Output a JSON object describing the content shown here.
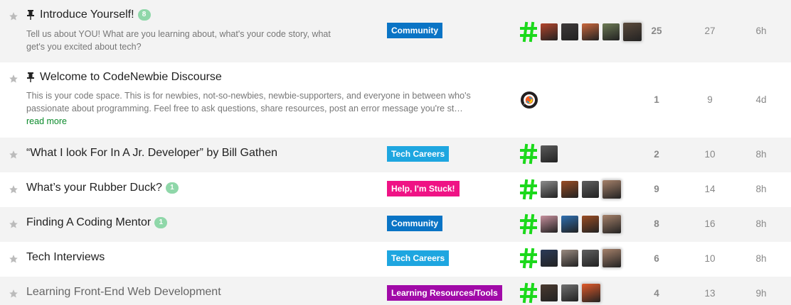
{
  "colors": {
    "row_alt": "#f3f3f3",
    "hash": "#1bd91b",
    "badge": "#8fd7a9",
    "link": "#0a8a2a"
  },
  "topics": [
    {
      "title": "Introduce Yourself!",
      "pinned": true,
      "badge": "8",
      "excerpt": [
        "Tell us about YOU! What are you learning about, what's your code story, what",
        "get's you excited about tech?"
      ],
      "category": {
        "label": "Community",
        "color": "#0a74c5"
      },
      "poster_icon": "hash-icon",
      "avatars": [
        "#b3452c",
        "#3e3a3a",
        "#c9673c",
        "#6d7b55",
        "#5b4a3c"
      ],
      "replies": "25",
      "views": "27",
      "activity": "6h"
    },
    {
      "title": "Welcome to CodeNewbie Discourse",
      "pinned": true,
      "excerpt": [
        "This is your code space. This is for newbies, not-so-newbies, newbie-supporters, and everyone in between who's",
        "passionate about programming. Feel free to ask questions, share resources, post an error message you're st…"
      ],
      "read_more": "read more",
      "poster_icon": "discourse-logo-icon",
      "replies": "1",
      "views": "9",
      "activity": "4d"
    },
    {
      "title": "“What I look For In A Jr. Developer” by Bill Gathen",
      "category": {
        "label": "Tech Careers",
        "color": "#1ea6e0"
      },
      "poster_icon": "hash-icon",
      "avatars": [
        "#5a5a5a"
      ],
      "replies": "2",
      "views": "10",
      "activity": "8h"
    },
    {
      "title": "What’s your Rubber Duck?",
      "badge": "1",
      "category": {
        "label": "Help, I'm Stuck!",
        "color": "#ef1385"
      },
      "poster_icon": "hash-icon",
      "avatars": [
        "#8c8c8c",
        "#9a4d24",
        "#606060",
        "#a5816a"
      ],
      "replies": "9",
      "views": "14",
      "activity": "8h"
    },
    {
      "title": "Finding A Coding Mentor",
      "badge": "1",
      "category": {
        "label": "Community",
        "color": "#0a74c5"
      },
      "poster_icon": "hash-icon",
      "avatars": [
        "#c58f9c",
        "#2f6fb0",
        "#9a4d24",
        "#a5816a"
      ],
      "replies": "8",
      "views": "16",
      "activity": "8h"
    },
    {
      "title": "Tech Interviews",
      "category": {
        "label": "Tech Careers",
        "color": "#1ea6e0"
      },
      "poster_icon": "hash-icon",
      "avatars": [
        "#2c3b58",
        "#9a8b80",
        "#606060",
        "#a5816a"
      ],
      "replies": "6",
      "views": "10",
      "activity": "8h"
    },
    {
      "title": "Learning Front-End Web Development",
      "visited": true,
      "category": {
        "label": "Learning Resources/Tools",
        "color": "#a10aa8"
      },
      "poster_icon": "hash-icon",
      "avatars": [
        "#4a3a30",
        "#707070",
        "#e05a2a"
      ],
      "replies": "4",
      "views": "13",
      "activity": "9h"
    }
  ]
}
